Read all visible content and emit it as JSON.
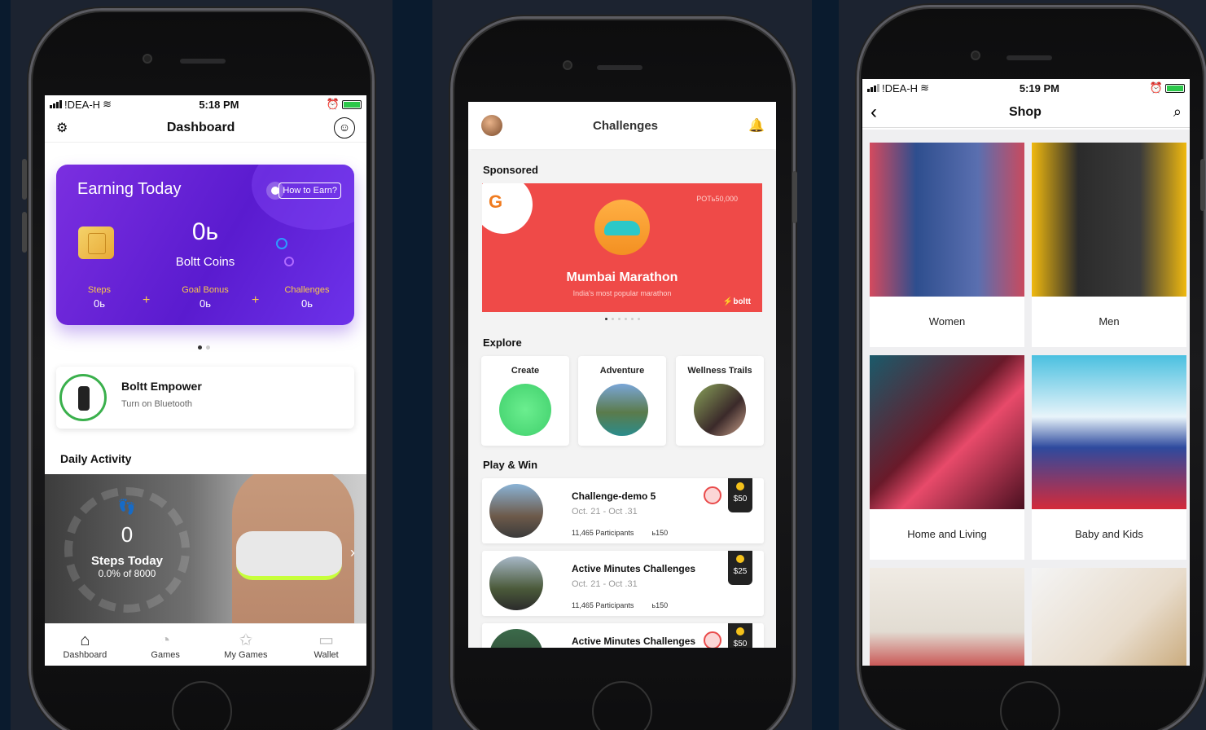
{
  "status": {
    "carrier": "!DEA-H"
  },
  "screen1": {
    "time": "5:18 PM",
    "title": "Dashboard",
    "earning": {
      "title": "Earning Today",
      "how_to": "How to Earn?",
      "coins_value": "0ь",
      "coins_label": "Boltt Coins",
      "stats": [
        {
          "label": "Steps",
          "value": "0ь"
        },
        {
          "label": "Goal Bonus",
          "value": "0ь"
        },
        {
          "label": "Challenges",
          "value": "0ь"
        }
      ],
      "plus": "+"
    },
    "empower": {
      "title": "Boltt Empower",
      "subtitle": "Turn on Bluetooth"
    },
    "daily_activity": "Daily Activity",
    "steps": {
      "value": "0",
      "label": "Steps Today",
      "progress": "0.0% of 8000"
    },
    "tabs": [
      {
        "label": "Dashboard",
        "icon": "home-icon"
      },
      {
        "label": "Games",
        "icon": "whistle-icon"
      },
      {
        "label": "My Games",
        "icon": "star-icon"
      },
      {
        "label": "Wallet",
        "icon": "wallet-icon"
      }
    ]
  },
  "screen2": {
    "title": "Challenges",
    "sponsored": "Sponsored",
    "banner": {
      "title": "Mumbai Marathon",
      "subtitle": "India's most popular marathon",
      "pot": "POTь50,000",
      "brand": "⚡boltt"
    },
    "explore": "Explore",
    "explore_items": [
      "Create",
      "Adventure",
      "Wellness Trails"
    ],
    "play_win": "Play & Win",
    "challenges": [
      {
        "name": "Challenge-demo 5",
        "dates": "Oct. 21 - Oct .31",
        "participants": "11,465 Participants",
        "entry": "ь150",
        "prize": "$50"
      },
      {
        "name": "Active Minutes Challenges",
        "dates": "Oct. 21 - Oct .31",
        "participants": "11,465 Participants",
        "entry": "ь150",
        "prize": "$25"
      },
      {
        "name": "Active Minutes Challenges",
        "dates": "",
        "participants": "",
        "entry": "",
        "prize": "$50"
      }
    ]
  },
  "screen3": {
    "time": "5:19 PM",
    "title": "Shop",
    "categories": [
      "Women",
      "Men",
      "Home and Living",
      "Baby and Kids"
    ]
  },
  "colors": {
    "accent_purple": "#6a24d8",
    "accent_green": "#3ab04c",
    "banner_red": "#ef4a48",
    "background": "#0a1b2e"
  }
}
